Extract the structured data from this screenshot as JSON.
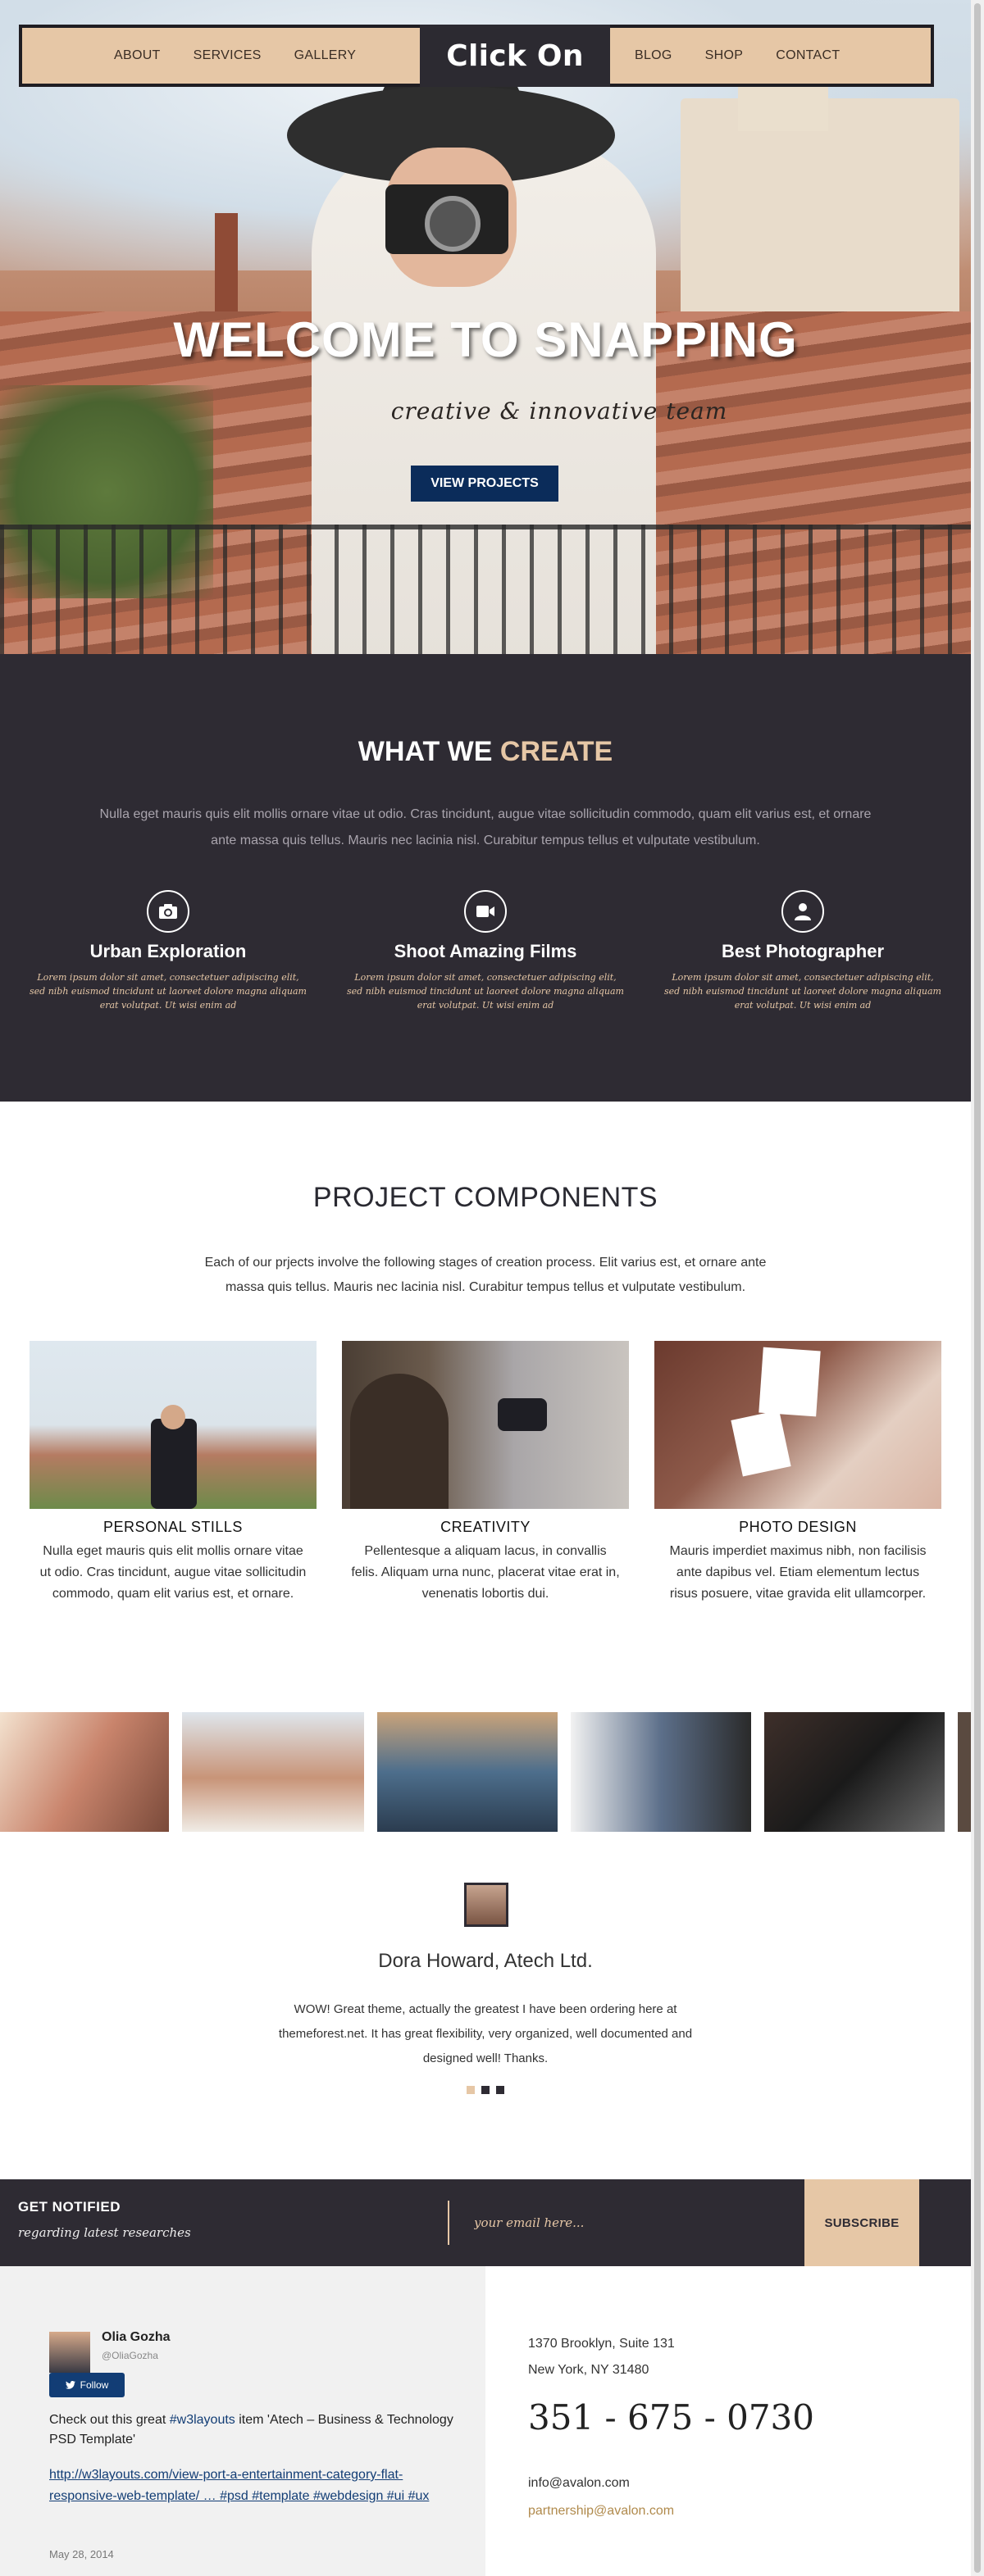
{
  "nav": {
    "left": [
      "ABOUT",
      "SERVICES",
      "GALLERY"
    ],
    "logo": "Click On",
    "right": [
      "BLOG",
      "SHOP",
      "CONTACT"
    ]
  },
  "hero": {
    "title": "WELCOME TO SNAPPING",
    "tagline": "creative & innovative team",
    "cta": "VIEW PROJECTS"
  },
  "create": {
    "title_main": "WHAT WE",
    "title_accent": "CREATE",
    "lead": "Nulla eget mauris quis elit mollis ornare vitae ut odio. Cras tincidunt, augue vitae sollicitudin commodo, quam elit varius est, et ornare ante massa quis tellus. Mauris nec lacinia nisl. Curabitur tempus tellus et vulputate vestibulum.",
    "features": [
      {
        "icon": "camera-icon",
        "title": "Urban Exploration",
        "text": "Lorem ipsum dolor sit amet, consectetuer adipiscing elit, sed nibh euismod tincidunt ut laoreet dolore magna aliquam erat volutpat. Ut wisi enim ad"
      },
      {
        "icon": "video-camera-icon",
        "title": "Shoot Amazing Films",
        "text": "Lorem ipsum dolor sit amet, consectetuer adipiscing elit, sed nibh euismod tincidunt ut laoreet dolore magna aliquam erat volutpat. Ut wisi enim ad"
      },
      {
        "icon": "user-icon",
        "title": "Best Photographer",
        "text": "Lorem ipsum dolor sit amet, consectetuer adipiscing elit, sed nibh euismod tincidunt ut laoreet dolore magna aliquam erat volutpat. Ut wisi enim ad"
      }
    ]
  },
  "projects": {
    "title": "PROJECT COMPONENTS",
    "lead": "Each of our prjects involve the following stages of creation process. Elit varius est, et ornare ante massa quis tellus. Mauris nec lacinia nisl. Curabitur tempus tellus et vulputate vestibulum.",
    "cards": [
      {
        "title": "PERSONAL STILLS",
        "text": "Nulla eget mauris quis elit mollis ornare vitae ut odio. Cras tincidunt, augue vitae sollicitudin commodo, quam elit varius est, et ornare."
      },
      {
        "title": "CREATIVITY",
        "text": "Pellentesque a aliquam lacus, in convallis felis. Aliquam urna nunc, placerat vitae erat in, venenatis lobortis dui."
      },
      {
        "title": "PHOTO DESIGN",
        "text": "Mauris imperdiet maximus nibh, non facilisis ante dapibus vel. Etiam elementum lectus risus posuere, vitae gravida elit ullamcorper."
      }
    ]
  },
  "testimonial": {
    "name": "Dora Howard, Atech Ltd.",
    "quote": "WOW! Great theme, actually the greatest I have been ordering here at themeforest.net. It has great flexibility, very organized, well documented and designed well! Thanks."
  },
  "newsletter": {
    "title": "GET NOTIFIED",
    "subtitle": "regarding latest researches",
    "placeholder": "your email here...",
    "button": "SUBSCRIBE"
  },
  "tweet": {
    "name": "Olia Gozha",
    "handle": "@OliaGozha",
    "follow": "Follow",
    "text_before": "Check out this great",
    "hashtag": "#w3layouts",
    "text_after": "item 'Atech – Business & Technology PSD Template'",
    "link": "http://w3layouts.com/view-port-a-entertainment-category-flat-responsive-web-template/ … #psd #template #webdesign #ui #ux",
    "date": "May 28, 2014"
  },
  "contact": {
    "address1": "1370 Brooklyn, Suite 131",
    "address2": "New York, NY 31480",
    "phone": "351 - 675 - 0730",
    "email1": "info@avalon.com",
    "email2": "partnership@avalon.com"
  },
  "colors": {
    "accent": "#e6c7a6",
    "dark": "#2e2b33",
    "navy": "#0b2c5a"
  }
}
